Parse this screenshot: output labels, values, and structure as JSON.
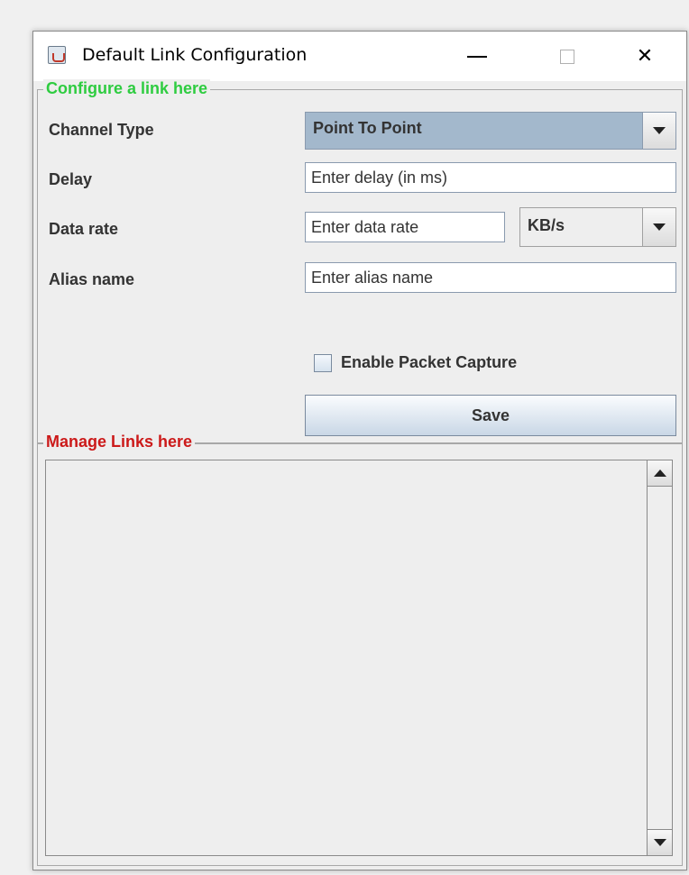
{
  "window": {
    "title": "Default Link Configuration",
    "icons": {
      "app": "java-cup-icon",
      "minimize": "minimize-icon",
      "maximize": "maximize-icon",
      "close": "close-icon"
    },
    "close_glyph": "✕"
  },
  "configure_panel": {
    "legend": "Configure a link here",
    "legend_color": "#2ecc40",
    "channel_type": {
      "label": "Channel Type",
      "selected": "Point To Point"
    },
    "delay": {
      "label": "Delay",
      "placeholder": "Enter delay (in ms)",
      "value": ""
    },
    "data_rate": {
      "label": "Data rate",
      "placeholder": "Enter data rate",
      "value": "",
      "unit_selected": "KB/s"
    },
    "alias": {
      "label": "Alias name",
      "placeholder": "Enter alias name",
      "value": ""
    },
    "packet_capture": {
      "label": "Enable Packet Capture",
      "checked": false
    },
    "save_label": "Save"
  },
  "manage_panel": {
    "legend": "Manage Links here",
    "legend_color": "#cc1a1a",
    "items": []
  }
}
